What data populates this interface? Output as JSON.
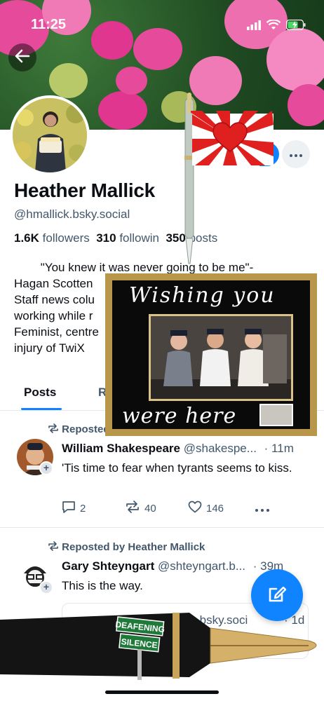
{
  "status_bar": {
    "time": "11:25"
  },
  "profile": {
    "display_name": "Heather Mallick",
    "handle": "@hmallick.bsky.social",
    "followers_count": "1.6K",
    "followers_label": "followers",
    "following_count": "310",
    "following_label": "followin",
    "posts_count": "350",
    "posts_label": "posts",
    "bio_lines": [
      "        \"You knew it was never going to be me\"-",
      "Hagan Scotten",
      "Staff news colu",
      "working while r",
      "Feminist, centre",
      "injury of TwiX"
    ]
  },
  "tabs": [
    {
      "label": "Posts"
    },
    {
      "label": "R"
    }
  ],
  "posts": [
    {
      "repost_label": "Reposted",
      "author_name": "William Shakespeare",
      "author_handle": "@shakespe...",
      "time": "· 11m",
      "text": "'Tis time to fear when tyrants seems to kiss.",
      "replies": "2",
      "reposts": "40",
      "likes": "146"
    },
    {
      "repost_label": "Reposted by Heather Mallick",
      "author_name": "Gary Shteyngart",
      "author_handle": "@shteyngart.b...",
      "time": "· 39m",
      "text": "This is the way.",
      "quote_handle_fragment": "81.bsky.soci",
      "quote_time_fragment": "· 1d"
    }
  ],
  "overlays": {
    "card_top_text": "Wishing you",
    "card_bottom_text": "were here",
    "street_sign_top": "DEAFENING",
    "street_sign_bottom": "SILENCE"
  },
  "colors": {
    "accent": "#1083fe",
    "muted_text": "#42576c",
    "divider": "#e4e8ec",
    "peony_pink": "#e0368f",
    "frame_gold": "#b8964a"
  },
  "icons": [
    "back-arrow-icon",
    "signal-icon",
    "wifi-icon",
    "battery-charging-icon",
    "ellipsis-icon",
    "repost-icon",
    "reply-icon",
    "like-icon",
    "compose-icon"
  ]
}
